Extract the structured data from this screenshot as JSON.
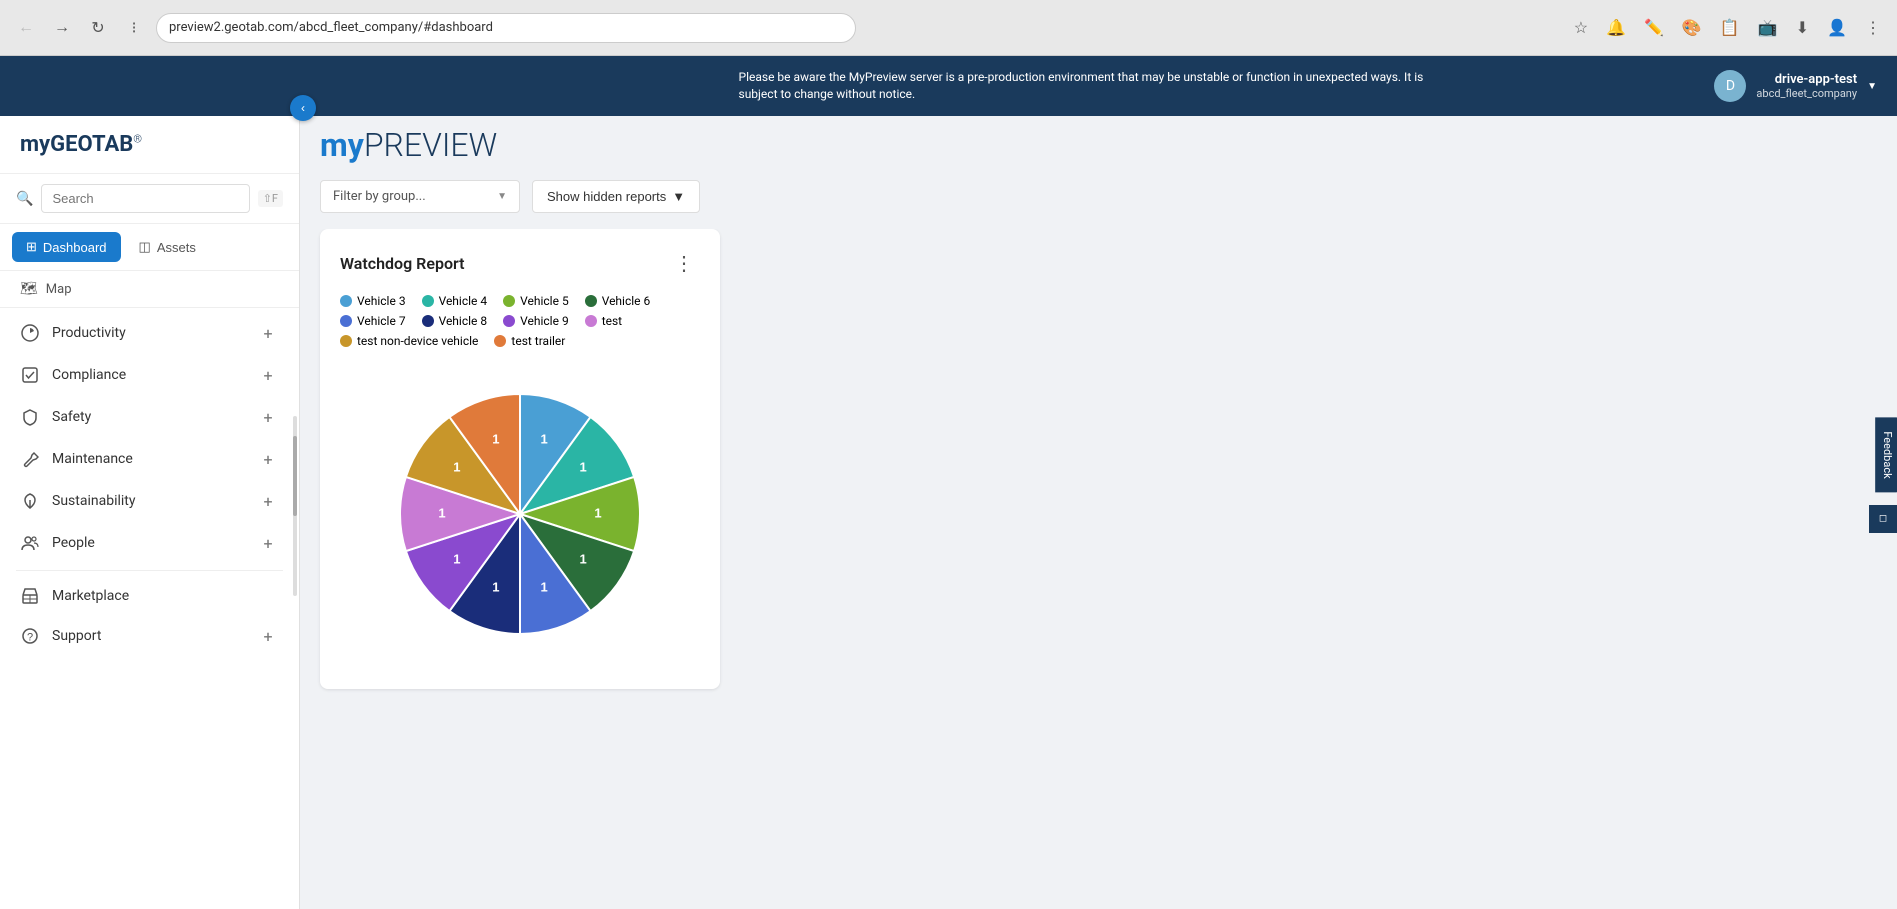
{
  "browser": {
    "url": "preview2.geotab.com/abcd_fleet_company/#dashboard",
    "back_disabled": false,
    "forward_disabled": false
  },
  "banner": {
    "text": "Please be aware the MyPreview server is a pre-production environment that may be unstable or function in unexpected ways. It is subject to change without notice.",
    "user": {
      "name": "drive-app-test",
      "company": "abcd_fleet_company",
      "avatar_label": "D"
    }
  },
  "logo": {
    "prefix": "my",
    "suffix": "GEOTAB",
    "trademark": "®"
  },
  "preview_title": {
    "my": "my",
    "preview": "PREVIEW"
  },
  "search": {
    "placeholder": "Search",
    "shortcut": "⇧F"
  },
  "nav_tabs": [
    {
      "id": "dashboard",
      "label": "Dashboard",
      "icon": "⊞",
      "active": true
    },
    {
      "id": "assets",
      "label": "Assets",
      "icon": "◫",
      "active": false
    }
  ],
  "map_link": {
    "label": "Map",
    "icon": "⊞"
  },
  "nav_items": [
    {
      "id": "productivity",
      "label": "Productivity",
      "icon": "circle",
      "has_add": true
    },
    {
      "id": "compliance",
      "label": "Compliance",
      "icon": "check-square",
      "has_add": true
    },
    {
      "id": "safety",
      "label": "Safety",
      "icon": "shield",
      "has_add": true
    },
    {
      "id": "maintenance",
      "label": "Maintenance",
      "icon": "wrench",
      "has_add": true
    },
    {
      "id": "sustainability",
      "label": "Sustainability",
      "icon": "leaf",
      "has_add": true
    },
    {
      "id": "people",
      "label": "People",
      "icon": "people",
      "has_add": true
    },
    {
      "id": "marketplace",
      "label": "Marketplace",
      "icon": "marketplace",
      "has_add": false
    },
    {
      "id": "support",
      "label": "Support",
      "icon": "question",
      "has_add": true
    }
  ],
  "toolbar": {
    "filter_placeholder": "Filter by group...",
    "hidden_reports_label": "Show hidden reports"
  },
  "watchdog": {
    "title": "Watchdog Report",
    "menu_icon": "⋮",
    "legend": [
      {
        "label": "Vehicle 3",
        "color": "#4a9fd4"
      },
      {
        "label": "Vehicle 4",
        "color": "#2ab5a5"
      },
      {
        "label": "Vehicle 5",
        "color": "#7ab32e"
      },
      {
        "label": "Vehicle 6",
        "color": "#2a6e3a"
      },
      {
        "label": "Vehicle 7",
        "color": "#4a6fd4"
      },
      {
        "label": "Vehicle 8",
        "color": "#1a2d7a"
      },
      {
        "label": "Vehicle 9",
        "color": "#8a4acf"
      },
      {
        "label": "test",
        "color": "#c87ad4"
      },
      {
        "label": "test non-device vehicle",
        "color": "#c8962a"
      },
      {
        "label": "test trailer",
        "color": "#e07a3a"
      }
    ],
    "pie_segments": [
      {
        "label": "Vehicle 3",
        "color": "#4a9fd4",
        "value": 1,
        "startAngle": 0,
        "endAngle": 36
      },
      {
        "label": "Vehicle 4",
        "color": "#2ab5a5",
        "value": 1,
        "startAngle": 36,
        "endAngle": 72
      },
      {
        "label": "Vehicle 5",
        "color": "#7ab32e",
        "value": 1,
        "startAngle": 72,
        "endAngle": 108
      },
      {
        "label": "Vehicle 6",
        "color": "#2a6e3a",
        "value": 1,
        "startAngle": 108,
        "endAngle": 144
      },
      {
        "label": "Vehicle 7",
        "color": "#4a6fd4",
        "value": 1,
        "startAngle": 144,
        "endAngle": 180
      },
      {
        "label": "Vehicle 8",
        "color": "#1a2d7a",
        "value": 1,
        "startAngle": 180,
        "endAngle": 216
      },
      {
        "label": "Vehicle 9",
        "color": "#8a4acf",
        "value": 1,
        "startAngle": 216,
        "endAngle": 252
      },
      {
        "label": "test",
        "color": "#c87ad4",
        "value": 1,
        "startAngle": 252,
        "endAngle": 288
      },
      {
        "label": "test non-device vehicle",
        "color": "#c8962a",
        "value": 1,
        "startAngle": 288,
        "endAngle": 324
      },
      {
        "label": "test trailer",
        "color": "#e07a3a",
        "value": 1,
        "startAngle": 324,
        "endAngle": 360
      }
    ]
  },
  "feedback": {
    "label": "Feedback"
  }
}
